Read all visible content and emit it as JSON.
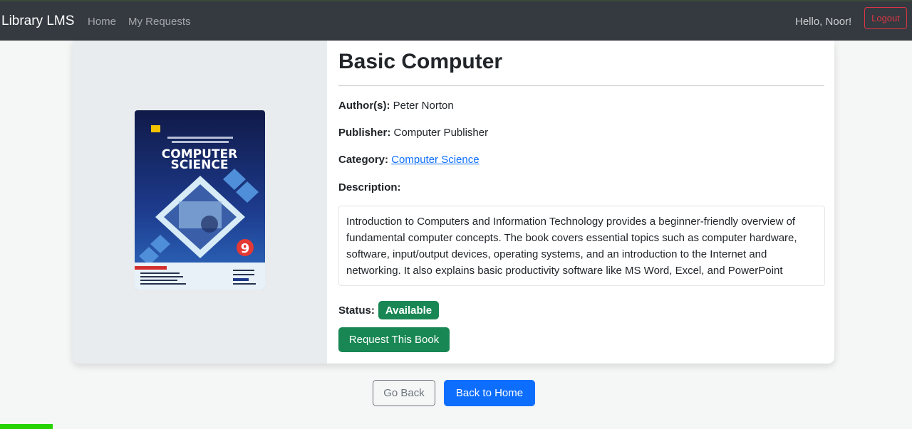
{
  "navbar": {
    "brand": "Library LMS",
    "links": [
      "Home",
      "My Requests"
    ],
    "greeting": "Hello, Noor!",
    "logout_label": "Logout"
  },
  "book": {
    "title": "Basic Computer",
    "author_label": "Author(s):",
    "author": "Peter Norton",
    "publisher_label": "Publisher:",
    "publisher": "Computer Publisher",
    "category_label": "Category:",
    "category": "Computer Science",
    "description_label": "Description:",
    "description": "Introduction to Computers and Information Technology provides a beginner-friendly overview of fundamental computer concepts. The book covers essential topics such as computer hardware, software, input/output devices, operating systems, and an introduction to the Internet and networking. It also explains basic productivity software like MS Word, Excel, and PowerPoint",
    "status_label": "Status:",
    "status": "Available",
    "cover": {
      "heading_line1": "COMPUTER",
      "heading_line2": "SCIENCE",
      "grade": "9"
    }
  },
  "actions": {
    "request_label": "Request This Book",
    "back_label": "Go Back",
    "home_label": "Back to Home"
  },
  "colors": {
    "navbar": "#343a40",
    "success": "#198754",
    "primary": "#0d6efd",
    "danger": "#dc3545"
  }
}
